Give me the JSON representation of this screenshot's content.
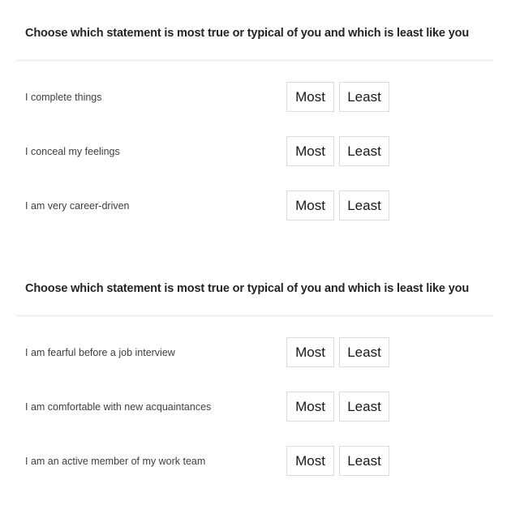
{
  "page": {
    "background_color": "#ffffff",
    "divider_color": "#f2f3f4",
    "button_border_color": "#dcdcdc",
    "text_color": "#3b3f44",
    "heading_color": "#22252a"
  },
  "choice_labels": {
    "most": "Most",
    "least": "Least"
  },
  "blocks": [
    {
      "heading": "Choose which statement is most true or typical of you and which is least like you",
      "statements": [
        {
          "text": "I complete things",
          "most": "Most",
          "least": "Least"
        },
        {
          "text": "I conceal my feelings",
          "most": "Most",
          "least": "Least"
        },
        {
          "text": "I am very career-driven",
          "most": "Most",
          "least": "Least"
        }
      ]
    },
    {
      "heading": "Choose which statement is most true or typical of you and which is least like you",
      "statements": [
        {
          "text": "I am fearful before a job interview",
          "most": "Most",
          "least": "Least"
        },
        {
          "text": "I am comfortable with new acquaintances",
          "most": "Most",
          "least": "Least"
        },
        {
          "text": "I am an active member of my work team",
          "most": "Most",
          "least": "Least"
        }
      ]
    }
  ]
}
